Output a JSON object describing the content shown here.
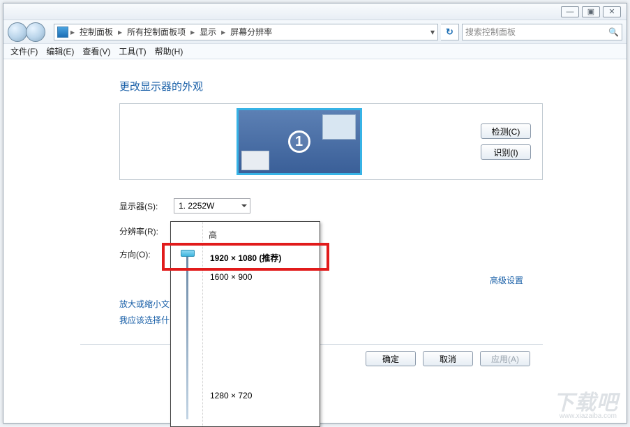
{
  "titlebar": {
    "min": "—",
    "max": "▣",
    "close": "✕"
  },
  "breadcrumb": {
    "items": [
      "控制面板",
      "所有控制面板项",
      "显示",
      "屏幕分辨率"
    ]
  },
  "search": {
    "placeholder": "搜索控制面板"
  },
  "menubar": {
    "items": [
      "文件(F)",
      "编辑(E)",
      "查看(V)",
      "工具(T)",
      "帮助(H)"
    ]
  },
  "heading": "更改显示器的外观",
  "buttons": {
    "detect": "检测(C)",
    "identify": "识别(I)",
    "ok": "确定",
    "cancel": "取消",
    "apply": "应用(A)"
  },
  "labels": {
    "display": "显示器(S):",
    "resolution": "分辨率(R):",
    "orientation": "方向(O):"
  },
  "display_select": "1. 2252W",
  "resolution_select": "1920 × 1080 (推荐)",
  "dropdown": {
    "top_label": "高",
    "options": [
      "1920 × 1080 (推荐)",
      "1600 × 900",
      "1280 × 720"
    ]
  },
  "links": {
    "advanced": "高级设置",
    "zoom": "放大或缩小文本",
    "help": "我应该选择什"
  },
  "monitor_number": "1",
  "watermark": "下载吧",
  "watermark_sub": "www.xiazaiba.com"
}
